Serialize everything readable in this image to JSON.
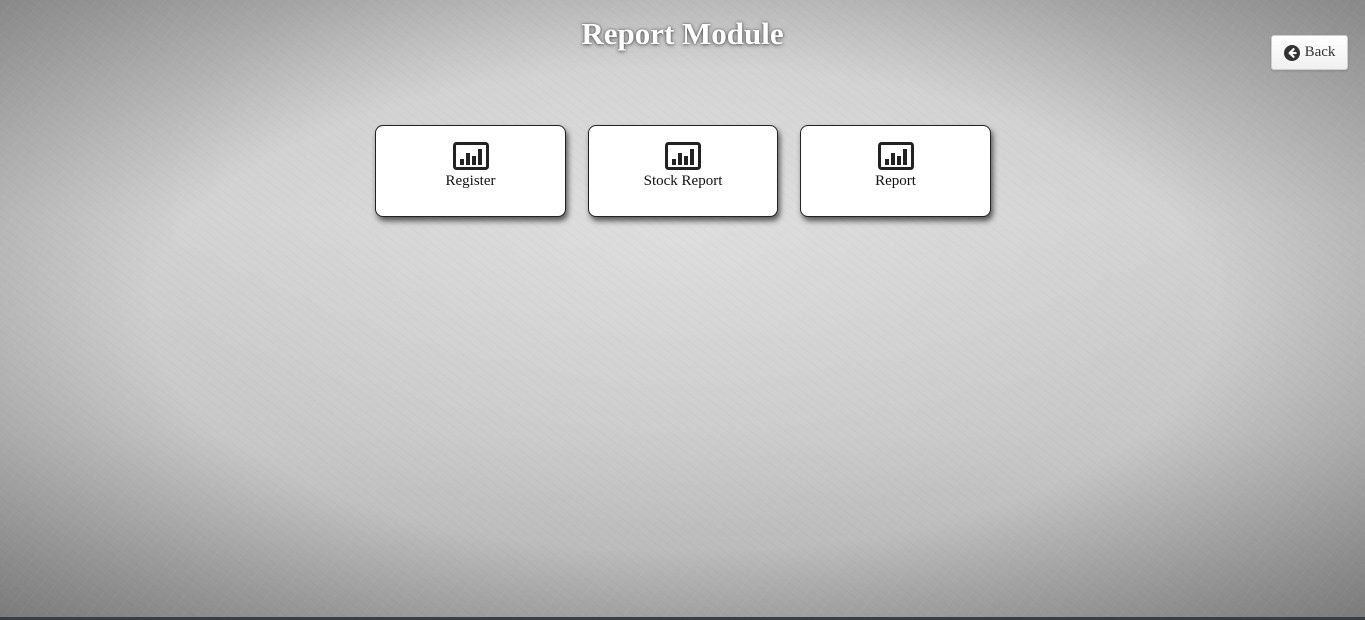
{
  "page": {
    "title": "Report Module"
  },
  "header": {
    "back_label": "Back",
    "back_icon": "arrow-circle-left-icon"
  },
  "tiles": [
    {
      "label": "Register",
      "icon": "bar-chart-icon"
    },
    {
      "label": "Stock Report",
      "icon": "bar-chart-icon"
    },
    {
      "label": "Report",
      "icon": "bar-chart-icon"
    }
  ],
  "colors": {
    "title": "#ffffff",
    "tile_background": "#ffffff",
    "tile_border": "#222222",
    "icon": "#222222"
  }
}
